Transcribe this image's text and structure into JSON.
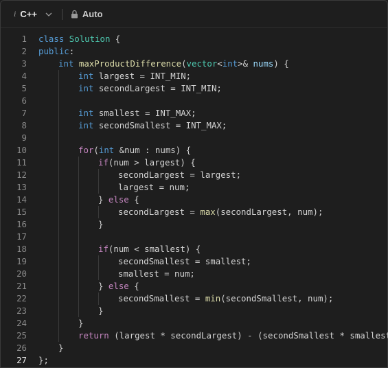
{
  "toolbar": {
    "language_icon": "info-italic-i",
    "language": "C++",
    "chevron_icon": "chevron-down",
    "lock_icon": "lock",
    "mode": "Auto"
  },
  "colors": {
    "background": "#1e1e1e",
    "text": "#d4d4d4",
    "keyword": "#569cd6",
    "type_name": "#4ec9b0",
    "function": "#dcdcaa",
    "variable": "#9cdcfe",
    "control": "#c586c0",
    "line_number": "#8a8a8a"
  },
  "editor": {
    "active_line": 27,
    "lines": [
      {
        "n": "1",
        "indent": 0,
        "tokens": [
          [
            "kw",
            "class"
          ],
          [
            "t",
            " "
          ],
          [
            "cls",
            "Solution"
          ],
          [
            "t",
            " {"
          ]
        ]
      },
      {
        "n": "2",
        "indent": 0,
        "tokens": [
          [
            "kw",
            "public"
          ],
          [
            "t",
            ":"
          ]
        ]
      },
      {
        "n": "3",
        "indent": 1,
        "tokens": [
          [
            "kw",
            "int"
          ],
          [
            "t",
            " "
          ],
          [
            "fn",
            "maxProductDifference"
          ],
          [
            "t",
            "("
          ],
          [
            "cls",
            "vector"
          ],
          [
            "t",
            "<"
          ],
          [
            "kw",
            "int"
          ],
          [
            "t",
            ">& "
          ],
          [
            "var",
            "nums"
          ],
          [
            "t",
            ") {"
          ]
        ]
      },
      {
        "n": "4",
        "indent": 2,
        "tokens": [
          [
            "kw",
            "int"
          ],
          [
            "t",
            " largest = INT_MIN;"
          ]
        ]
      },
      {
        "n": "5",
        "indent": 2,
        "tokens": [
          [
            "kw",
            "int"
          ],
          [
            "t",
            " secondLargest = INT_MIN;"
          ]
        ]
      },
      {
        "n": "6",
        "indent": 2,
        "tokens": []
      },
      {
        "n": "7",
        "indent": 2,
        "tokens": [
          [
            "kw",
            "int"
          ],
          [
            "t",
            " smallest = INT_MAX;"
          ]
        ]
      },
      {
        "n": "8",
        "indent": 2,
        "tokens": [
          [
            "kw",
            "int"
          ],
          [
            "t",
            " secondSmallest = INT_MAX;"
          ]
        ]
      },
      {
        "n": "9",
        "indent": 2,
        "tokens": []
      },
      {
        "n": "10",
        "indent": 2,
        "tokens": [
          [
            "ctl",
            "for"
          ],
          [
            "t",
            "("
          ],
          [
            "kw",
            "int"
          ],
          [
            "t",
            " &num : nums) {"
          ]
        ]
      },
      {
        "n": "11",
        "indent": 3,
        "tokens": [
          [
            "ctl",
            "if"
          ],
          [
            "t",
            "(num > largest) {"
          ]
        ]
      },
      {
        "n": "12",
        "indent": 4,
        "tokens": [
          [
            "t",
            "secondLargest = largest;"
          ]
        ]
      },
      {
        "n": "13",
        "indent": 4,
        "tokens": [
          [
            "t",
            "largest = num;"
          ]
        ]
      },
      {
        "n": "14",
        "indent": 3,
        "tokens": [
          [
            "t",
            "} "
          ],
          [
            "ctl",
            "else"
          ],
          [
            "t",
            " {"
          ]
        ]
      },
      {
        "n": "15",
        "indent": 4,
        "tokens": [
          [
            "t",
            "secondLargest = "
          ],
          [
            "fn",
            "max"
          ],
          [
            "t",
            "(secondLargest, num);"
          ]
        ]
      },
      {
        "n": "16",
        "indent": 3,
        "tokens": [
          [
            "t",
            "}"
          ]
        ]
      },
      {
        "n": "17",
        "indent": 3,
        "tokens": []
      },
      {
        "n": "18",
        "indent": 3,
        "tokens": [
          [
            "ctl",
            "if"
          ],
          [
            "t",
            "(num < smallest) {"
          ]
        ]
      },
      {
        "n": "19",
        "indent": 4,
        "tokens": [
          [
            "t",
            "secondSmallest = smallest;"
          ]
        ]
      },
      {
        "n": "20",
        "indent": 4,
        "tokens": [
          [
            "t",
            "smallest = num;"
          ]
        ]
      },
      {
        "n": "21",
        "indent": 3,
        "tokens": [
          [
            "t",
            "} "
          ],
          [
            "ctl",
            "else"
          ],
          [
            "t",
            " {"
          ]
        ]
      },
      {
        "n": "22",
        "indent": 4,
        "tokens": [
          [
            "t",
            "secondSmallest = "
          ],
          [
            "fn",
            "min"
          ],
          [
            "t",
            "(secondSmallest, num);"
          ]
        ]
      },
      {
        "n": "23",
        "indent": 3,
        "tokens": [
          [
            "t",
            "}"
          ]
        ]
      },
      {
        "n": "24",
        "indent": 2,
        "tokens": [
          [
            "t",
            "}"
          ]
        ]
      },
      {
        "n": "25",
        "indent": 2,
        "tokens": [
          [
            "ctl",
            "return"
          ],
          [
            "t",
            " (largest * secondLargest) - (secondSmallest * smallest);"
          ]
        ]
      },
      {
        "n": "26",
        "indent": 1,
        "tokens": [
          [
            "t",
            "}"
          ]
        ]
      },
      {
        "n": "27",
        "indent": 0,
        "tokens": [
          [
            "t",
            "};"
          ]
        ]
      }
    ]
  }
}
